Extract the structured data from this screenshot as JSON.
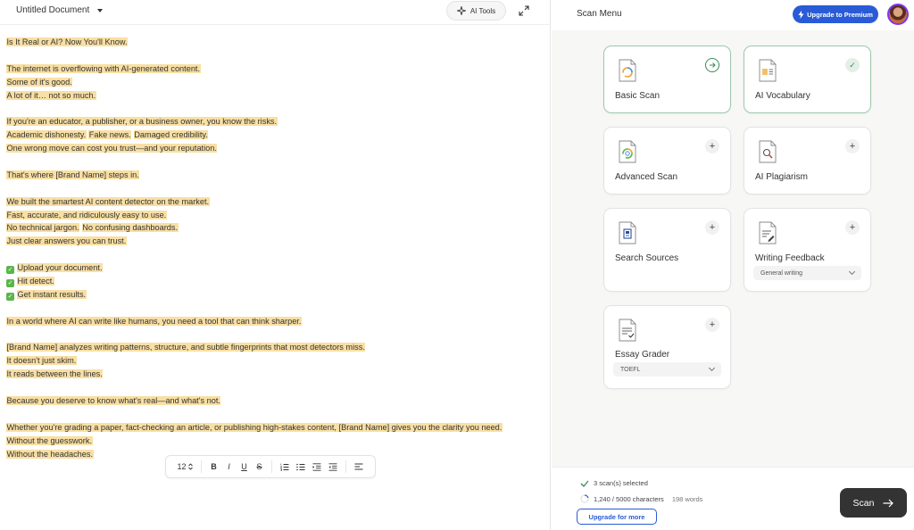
{
  "editor": {
    "doc_title": "Untitled Document",
    "ai_tools_label": "AI Tools",
    "lines": [
      {
        "segments": [
          "Is It Real or AI? Now You'll Know."
        ]
      },
      {
        "segments": []
      },
      {
        "segments": [
          "The internet is overflowing with AI-generated content."
        ]
      },
      {
        "segments": [
          "Some of it's good."
        ]
      },
      {
        "segments": [
          "A lot of it… not so much."
        ]
      },
      {
        "segments": []
      },
      {
        "segments": [
          "If you're an educator, a publisher, or a business owner, you know the risks."
        ]
      },
      {
        "segments": [
          "Academic dishonesty.",
          "Fake news.",
          "Damaged credibility."
        ]
      },
      {
        "segments": [
          "One wrong move can cost you trust—and your reputation."
        ]
      },
      {
        "segments": []
      },
      {
        "segments": [
          "That's where [Brand Name] steps in."
        ]
      },
      {
        "segments": []
      },
      {
        "segments": [
          "We built the smartest AI content detector on the market."
        ]
      },
      {
        "segments": [
          "Fast, accurate, and ridiculously easy to use."
        ]
      },
      {
        "segments": [
          "No technical jargon.",
          "No confusing dashboards."
        ]
      },
      {
        "segments": [
          "Just clear answers you can trust."
        ]
      },
      {
        "segments": []
      },
      {
        "check": true,
        "segments": [
          "Upload your document."
        ]
      },
      {
        "check": true,
        "segments": [
          "Hit detect."
        ]
      },
      {
        "check": true,
        "segments": [
          "Get instant results."
        ]
      },
      {
        "segments": []
      },
      {
        "segments": [
          "In a world where AI can write like humans, you need a tool that can think sharper."
        ]
      },
      {
        "segments": []
      },
      {
        "segments": [
          "[Brand Name] analyzes writing patterns, structure, and subtle fingerprints that most detectors miss."
        ]
      },
      {
        "segments": [
          "It doesn't just skim."
        ]
      },
      {
        "segments": [
          "It reads between the lines."
        ]
      },
      {
        "segments": []
      },
      {
        "segments": [
          "Because you deserve to know what's real—and what's not."
        ]
      },
      {
        "segments": []
      },
      {
        "segments": [
          "Whether you're grading a paper, fact-checking an article, or publishing high-stakes content, [Brand Name] gives you the clarity you need."
        ]
      },
      {
        "segments": [
          "Without the guesswork."
        ]
      },
      {
        "segments": [
          "Without the headaches."
        ]
      }
    ],
    "toolbar": {
      "font_size": "12",
      "bold": "B",
      "italic": "I",
      "underline": "U",
      "strike": "S"
    }
  },
  "scan_panel": {
    "title": "Scan Menu",
    "upgrade_label": "Upgrade to Premium",
    "cards": {
      "basic": {
        "label": "Basic Scan",
        "state": "arrow"
      },
      "vocab": {
        "label": "AI Vocabulary",
        "state": "check"
      },
      "advanced": {
        "label": "Advanced Scan",
        "state": "plus"
      },
      "plagiarism": {
        "label": "AI Plagiarism",
        "state": "plus"
      },
      "sources": {
        "label": "Search Sources",
        "state": "plus"
      },
      "feedback": {
        "label": "Writing Feedback",
        "state": "plus",
        "option": "General writing"
      },
      "grader": {
        "label": "Essay Grader",
        "state": "plus",
        "option": "TOEFL"
      }
    },
    "footer": {
      "selected_text": "3 scan(s) selected",
      "characters_text": "1,240 / 5000 characters",
      "words_text": "198 words",
      "upgrade_more_label": "Upgrade for more",
      "scan_label": "Scan"
    },
    "colors": {
      "accent_blue": "#2a5bd7",
      "selected_green": "#3a8a5a",
      "highlight": "#f8dfa3"
    }
  }
}
